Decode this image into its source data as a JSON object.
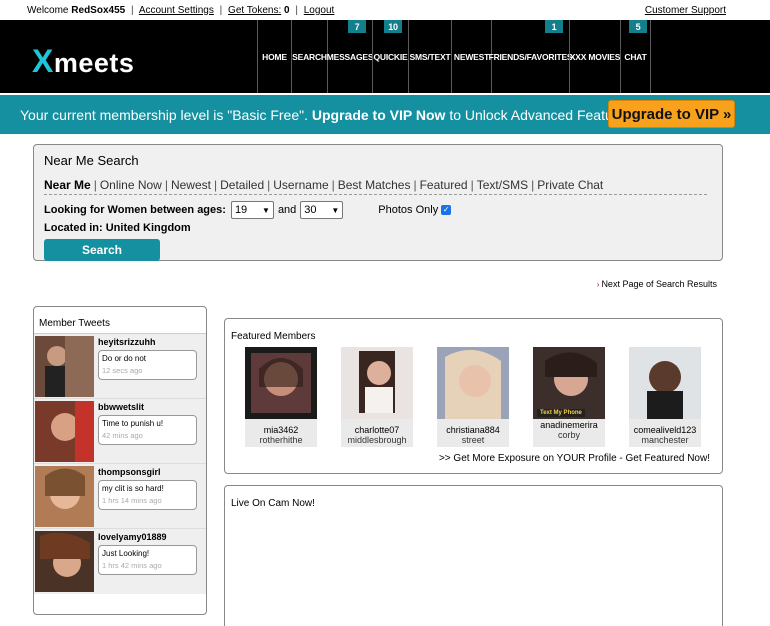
{
  "topbar": {
    "welcome": "Welcome",
    "username": "RedSox455",
    "account_settings": "Account Settings",
    "get_tokens": "Get Tokens:",
    "tokens": "0",
    "logout": "Logout",
    "customer_support": "Customer Support"
  },
  "header": {
    "logo_x": "X",
    "logo_rest": "meets",
    "nav": [
      {
        "label": "HOME",
        "badge": ""
      },
      {
        "label": "SEARCH",
        "badge": ""
      },
      {
        "label": "MESSAGES",
        "badge": "7"
      },
      {
        "label": "QUICKIE",
        "badge": "10"
      },
      {
        "label": "SMS/TEXT",
        "badge": ""
      },
      {
        "label": "NEWEST",
        "badge": ""
      },
      {
        "label": "FRIENDS/FAVORITES",
        "badge": "1"
      },
      {
        "label": "XXX MOVIES",
        "badge": ""
      },
      {
        "label": "CHAT",
        "badge": "5"
      }
    ]
  },
  "banner": {
    "text_1": "Your current membership level is \"Basic Free\".",
    "text_bold": "Upgrade to VIP Now",
    "text_2": "to Unlock Advanced Features.",
    "button": "Upgrade to VIP »"
  },
  "search": {
    "title": "Near Me Search",
    "tabs": [
      "Near Me",
      "Online Now",
      "Newest",
      "Detailed",
      "Username",
      "Best Matches",
      "Featured",
      "Text/SMS",
      "Private Chat"
    ],
    "age_label": "Looking for Women between ages:",
    "age_from": "19",
    "and": "and",
    "age_to": "30",
    "photos_only": "Photos Only",
    "located": "Located in: United Kingdom",
    "button": "Search"
  },
  "next_page": "Next Page of Search Results",
  "tweets": {
    "title": "Member Tweets",
    "items": [
      {
        "user": "heyitsrizzuhh",
        "text": "Do or do not",
        "time": "12 secs ago"
      },
      {
        "user": "bbwwetslit",
        "text": "Time to punish u!",
        "time": "42 mins ago"
      },
      {
        "user": "thompsonsgirl",
        "text": "my clit is so hard!",
        "time": "1 hrs 14 mins ago"
      },
      {
        "user": "lovelyamy01889",
        "text": "Just Looking!",
        "time": "1 hrs 42 mins ago"
      }
    ]
  },
  "featured": {
    "title": "Featured Members",
    "members": [
      {
        "name": "mia3462",
        "location": "rotherhithe"
      },
      {
        "name": "charlotte07",
        "location": "middlesbrough"
      },
      {
        "name": "christiana884",
        "location": "street"
      },
      {
        "name": "anadinemerira",
        "location": "corby",
        "overlay": "Text My Phone"
      },
      {
        "name": "comealiveld123",
        "location": "manchester"
      }
    ],
    "get_more": ">> Get More Exposure on YOUR Profile - Get Featured Now!"
  },
  "livecam": {
    "title": "Live On Cam Now!"
  }
}
